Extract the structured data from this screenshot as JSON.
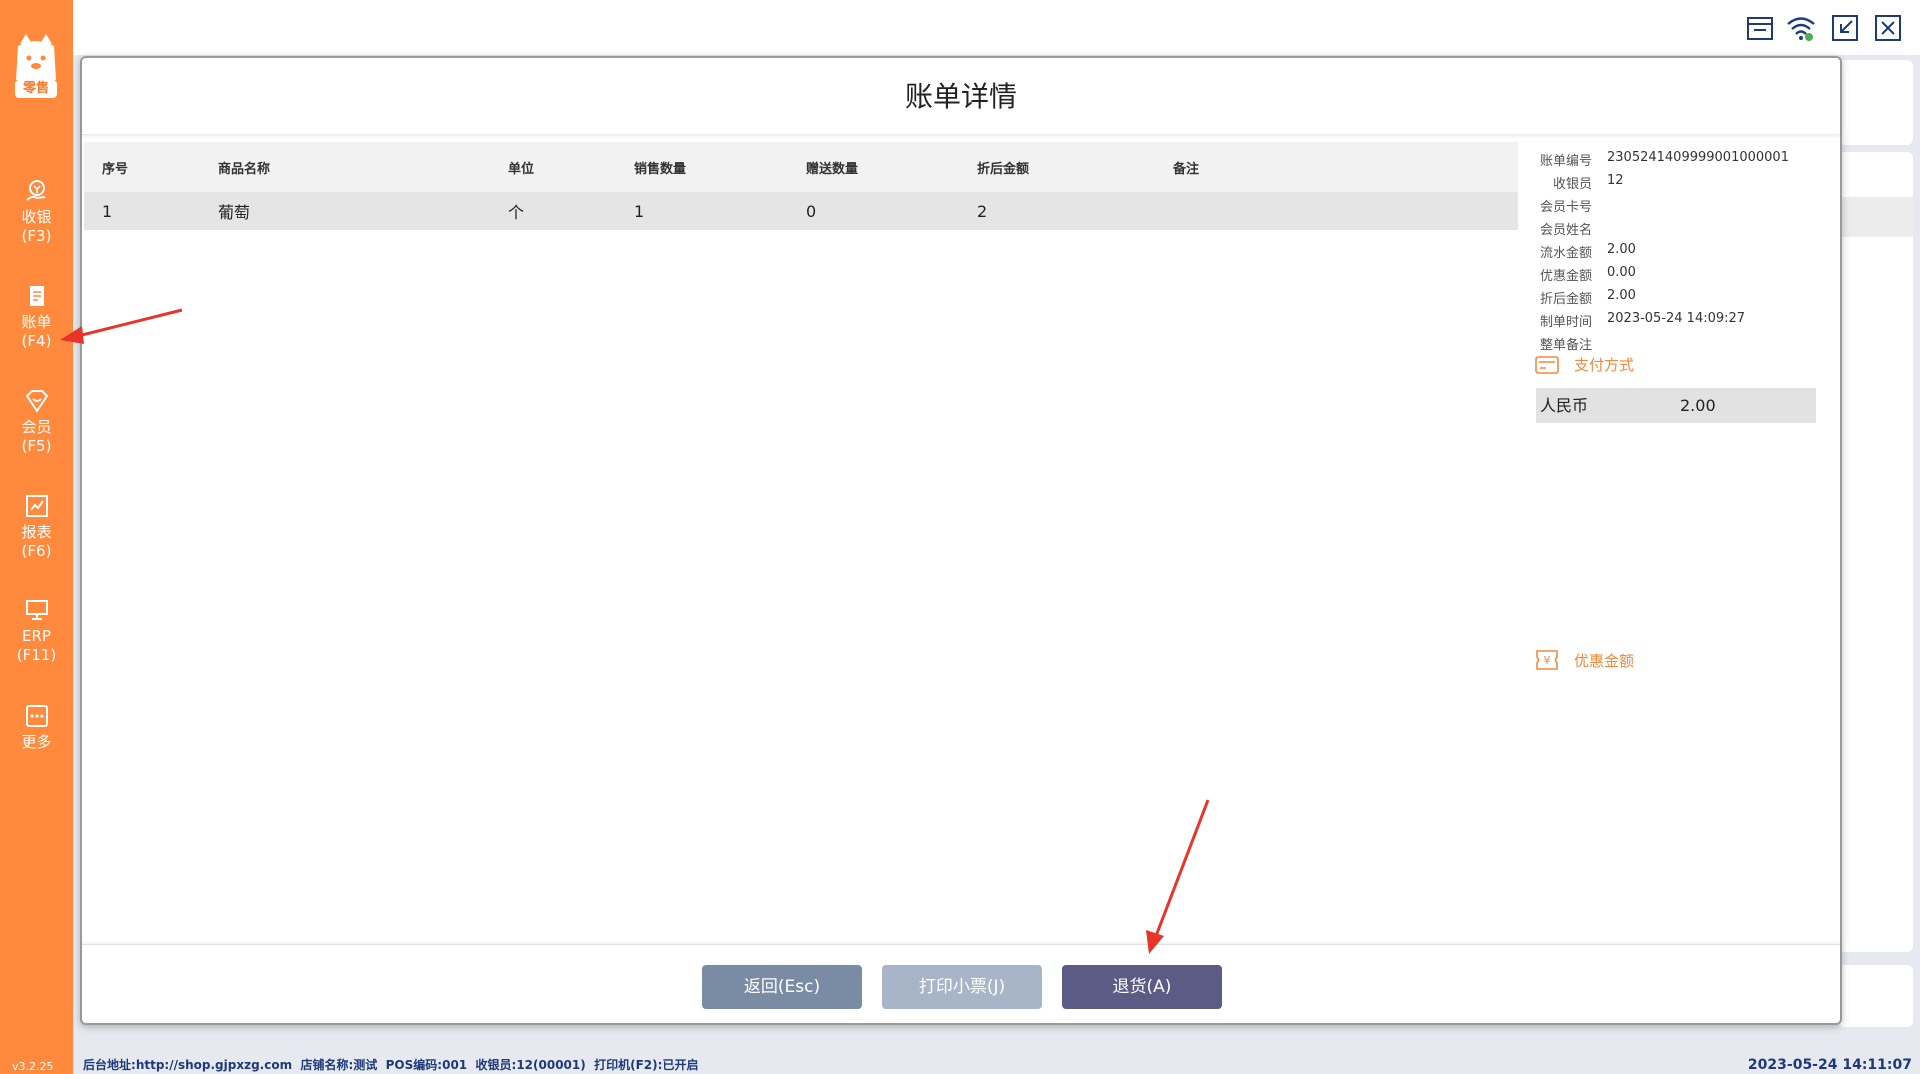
{
  "colors": {
    "sidebar": "#ff8a3d",
    "accent": "#f08a3c",
    "back_button": "#7a8ca3",
    "print_button": "#a8b4c8",
    "return_button": "#5b5b86",
    "annotation_arrow": "#e8352a"
  },
  "sidebar": {
    "logo_text": "零售",
    "items": [
      {
        "label": "收银",
        "key": "(F3)",
        "icon": "cashier-icon"
      },
      {
        "label": "账单",
        "key": "(F4)",
        "icon": "bill-icon"
      },
      {
        "label": "会员",
        "key": "(F5)",
        "icon": "member-icon"
      },
      {
        "label": "报表",
        "key": "(F6)",
        "icon": "report-icon"
      },
      {
        "label": "ERP",
        "key": "(F11)",
        "icon": "erp-monitor-icon"
      },
      {
        "label": "更多",
        "key": "",
        "icon": "more-icon"
      }
    ],
    "version": "v3.2.25"
  },
  "toolbar": {
    "icons": [
      "store-icon",
      "wifi-icon",
      "shrink-icon",
      "close-icon"
    ]
  },
  "modal": {
    "title": "账单详情",
    "table": {
      "headers": [
        "序号",
        "商品名称",
        "单位",
        "销售数量",
        "赠送数量",
        "折后金额",
        "备注"
      ],
      "rows": [
        [
          "1",
          "葡萄",
          "个",
          "1",
          "0",
          "2",
          ""
        ]
      ]
    },
    "info": {
      "bill_no_label": "账单编号",
      "bill_no": "2305241409999001000001",
      "cashier_label": "收银员",
      "cashier": "12",
      "member_card_label": "会员卡号",
      "member_card": "",
      "member_name_label": "会员姓名",
      "member_name": "",
      "flow_amount_label": "流水金额",
      "flow_amount": "2.00",
      "discount_amount_label": "优惠金额",
      "discount_amount": "0.00",
      "after_discount_label": "折后金额",
      "after_discount": "2.00",
      "created_time_label": "制单时间",
      "created_time": "2023-05-24 14:09:27",
      "remark_label": "整单备注"
    },
    "payment": {
      "title": "支付方式",
      "rows": [
        {
          "method": "人民币",
          "amount": "2.00"
        }
      ]
    },
    "discount_section_title": "优惠金额",
    "buttons": {
      "back": "返回(Esc)",
      "print": "打印小票(J)",
      "return": "退货(A)"
    }
  },
  "status": {
    "backend_label": "后台地址:",
    "backend_url": "http://shop.gjpxzg.com",
    "store_label": "店铺名称:",
    "store": "测试",
    "pos_label": "POS编码:",
    "pos": "001",
    "cashier_label": "收银员:",
    "cashier": "12(00001)",
    "printer_label": "打印机(F2):",
    "printer": "已开启",
    "datetime": "2023-05-24 14:11:07"
  }
}
